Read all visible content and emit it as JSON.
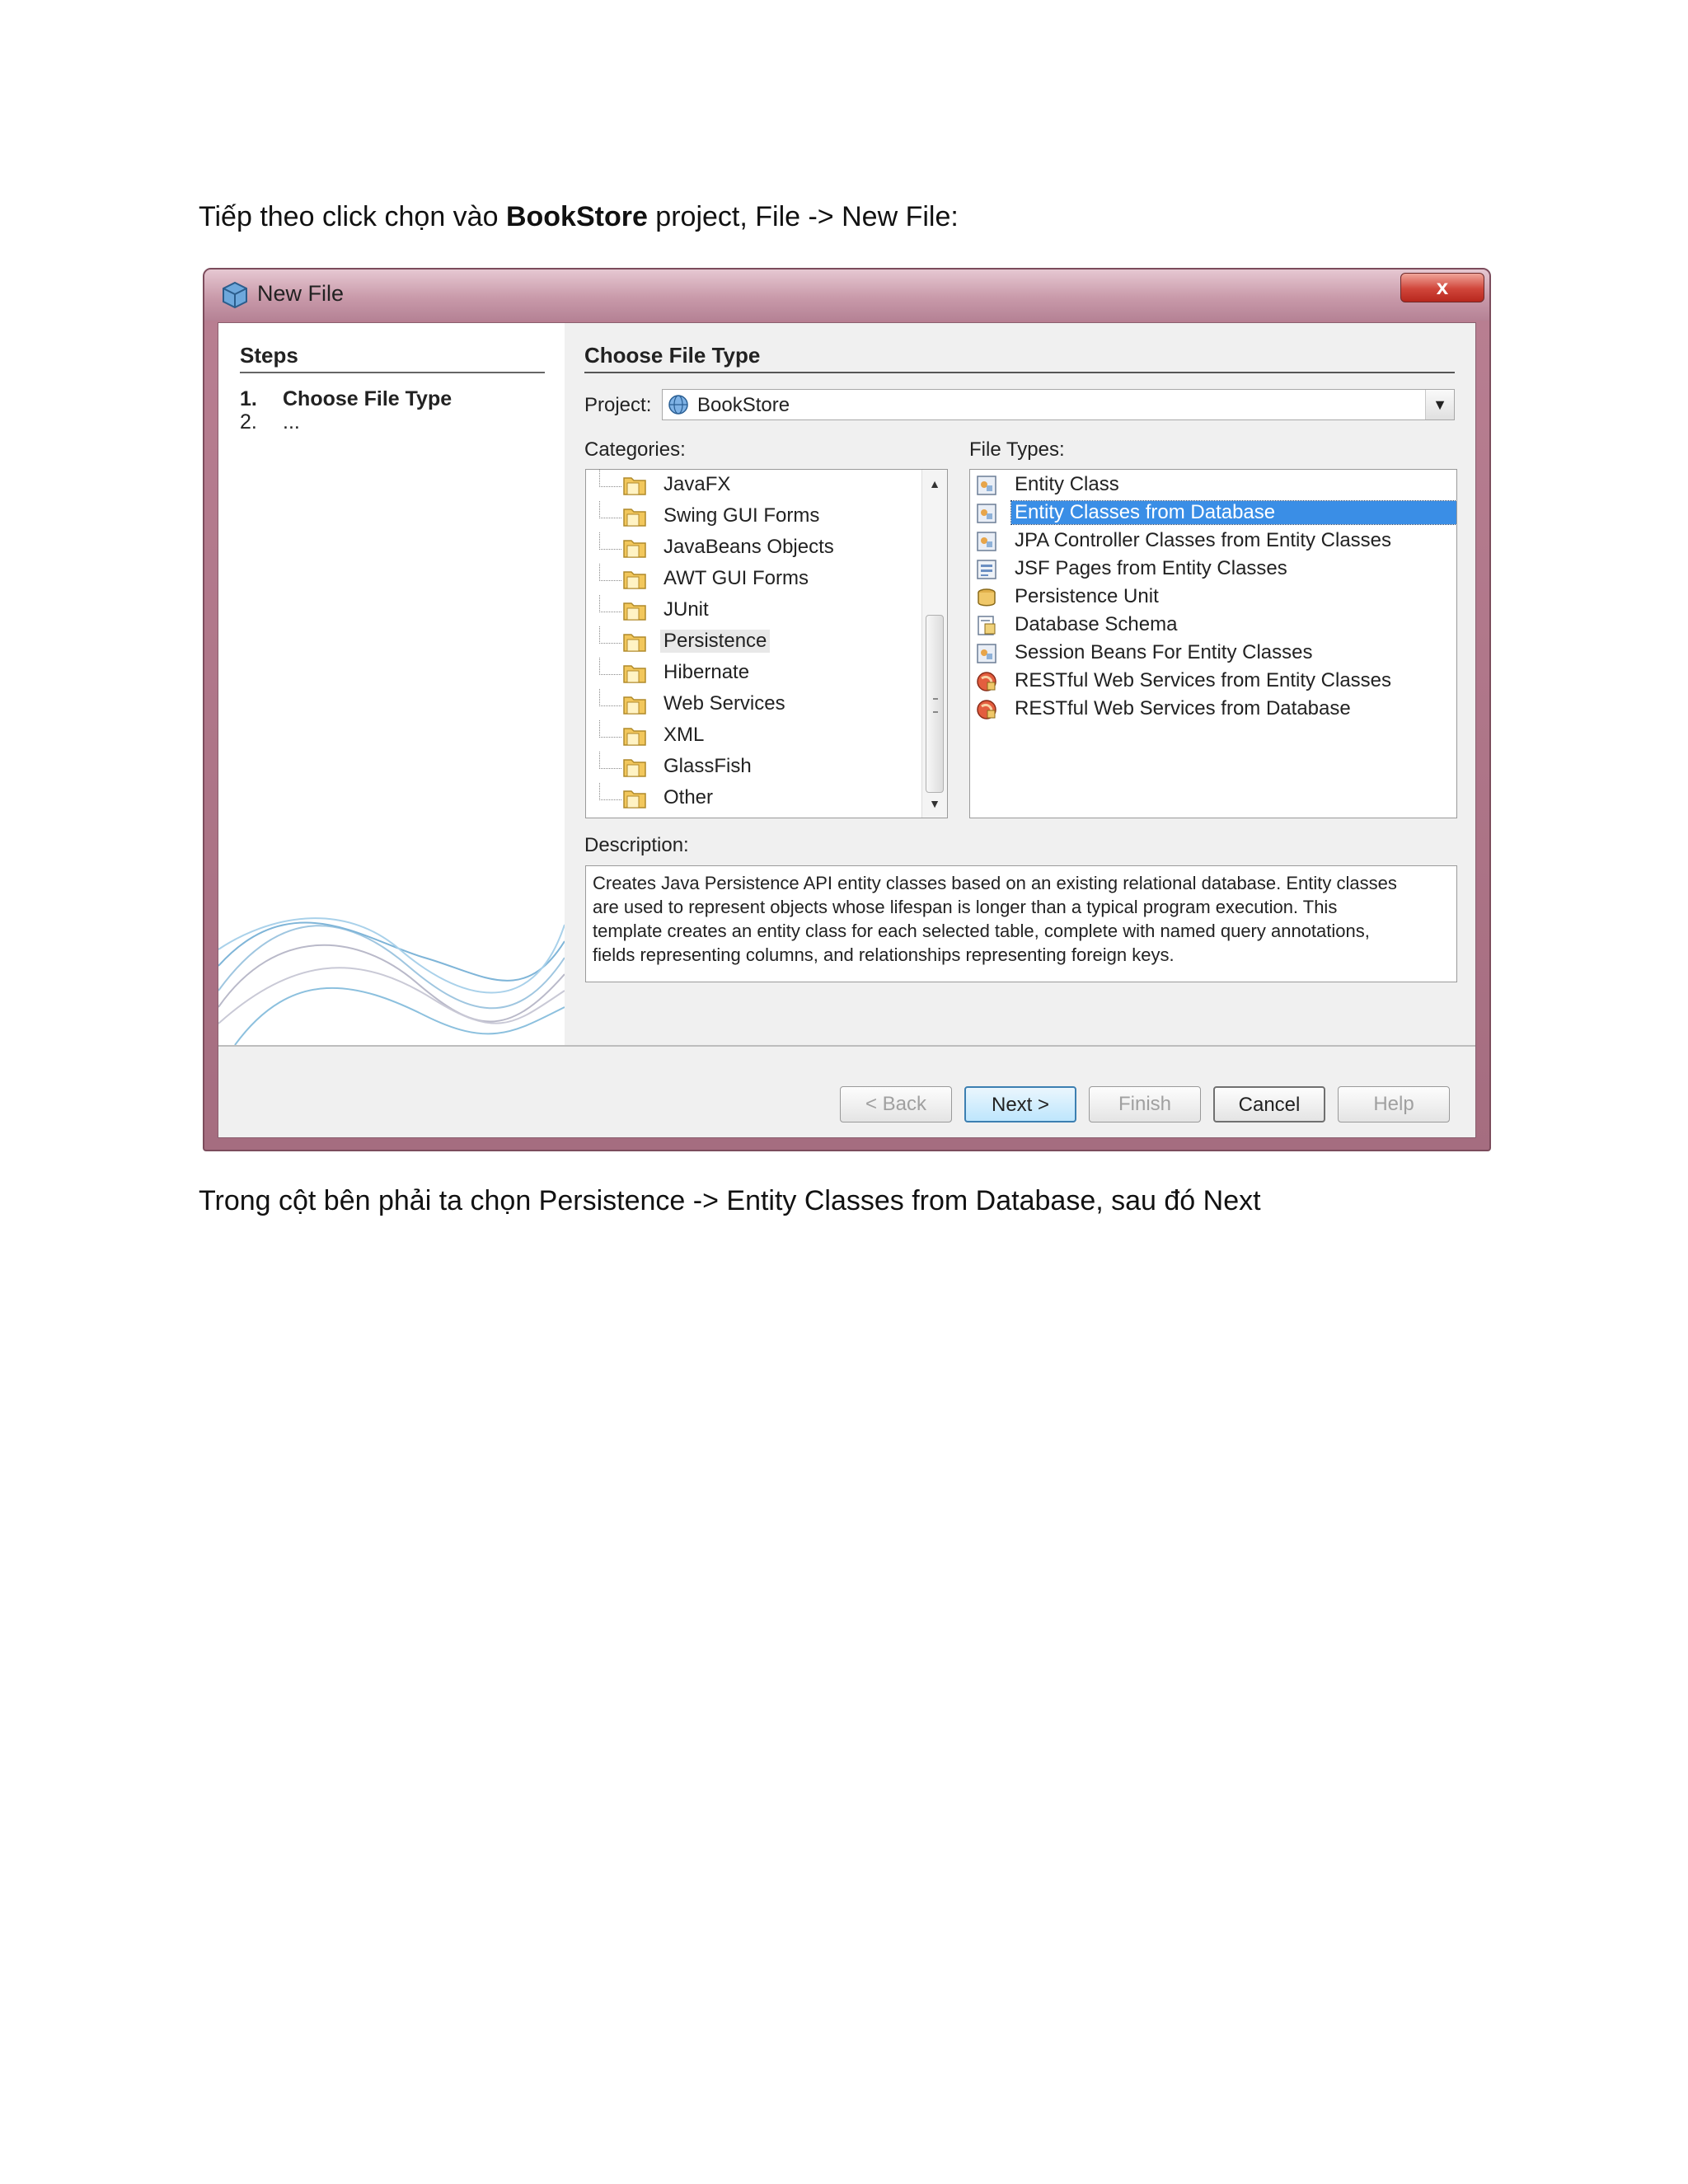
{
  "para1": {
    "prefix": "Tiếp theo click chọn vào ",
    "bold": "BookStore",
    "suffix": " project, File -> New File:"
  },
  "para2": "Trong cột bên phải ta chọn Persistence -> Entity Classes from Database, sau đó Next",
  "dialog": {
    "title": "New File",
    "close_label": "x",
    "steps": {
      "heading": "Steps",
      "items": [
        {
          "num": "1.",
          "label": "Choose File Type"
        },
        {
          "num": "2.",
          "label": "..."
        }
      ]
    },
    "section_title": "Choose File Type",
    "project_label": "Project:",
    "project_value": "BookStore",
    "categories_label": "Categories:",
    "categories": [
      "JavaFX",
      "Swing GUI Forms",
      "JavaBeans Objects",
      "AWT GUI Forms",
      "JUnit",
      "Persistence",
      "Hibernate",
      "Web Services",
      "XML",
      "GlassFish",
      "Other"
    ],
    "file_types_label": "File Types:",
    "file_types": [
      "Entity Class",
      "Entity Classes from Database",
      "JPA Controller Classes from Entity Classes",
      "JSF Pages from Entity Classes",
      "Persistence Unit",
      "Database Schema",
      "Session Beans For Entity Classes",
      "RESTful Web Services from Entity Classes",
      "RESTful Web Services from Database"
    ],
    "description_label": "Description:",
    "description_lines": [
      "Creates Java Persistence API entity classes based on an existing relational database. Entity classes",
      "are used to represent objects whose lifespan is longer than a typical program execution. This",
      "template creates an entity class for each selected table, complete with named query annotations,",
      "fields representing columns, and relationships representing foreign keys."
    ],
    "buttons": {
      "back": "< Back",
      "next": "Next >",
      "finish": "Finish",
      "cancel": "Cancel",
      "help": "Help"
    }
  }
}
